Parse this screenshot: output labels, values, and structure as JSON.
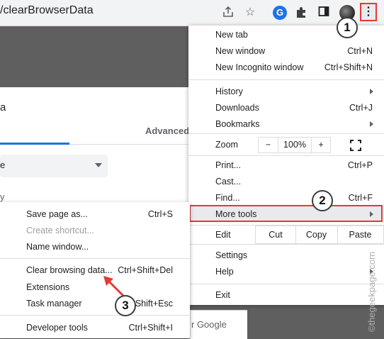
{
  "toolbar": {
    "url": "/clearBrowserData",
    "share_icon": "share-icon",
    "star_icon": "star-icon",
    "profile_letter": "G",
    "extensions_icon": "puzzle-icon",
    "sidepanel_icon": "side-panel-icon",
    "menu_icon": "⋮"
  },
  "background_page": {
    "title_fragment": "a",
    "advanced_tab": "Advanced",
    "select_fragment": "e",
    "label_fragment": "y",
    "google_fragment": "r Google"
  },
  "menu": {
    "new_tab": "New tab",
    "new_tab_shortcut": "",
    "new_window": "New window",
    "new_window_shortcut": "Ctrl+N",
    "new_incognito": "New Incognito window",
    "new_incognito_shortcut": "Ctrl+Shift+N",
    "history": "History",
    "downloads": "Downloads",
    "downloads_shortcut": "Ctrl+J",
    "bookmarks": "Bookmarks",
    "zoom": "Zoom",
    "zoom_minus": "−",
    "zoom_value": "100%",
    "zoom_plus": "+",
    "print": "Print...",
    "print_shortcut": "Ctrl+P",
    "cast": "Cast...",
    "find": "Find...",
    "find_shortcut": "Ctrl+F",
    "more_tools": "More tools",
    "edit": "Edit",
    "cut": "Cut",
    "copy": "Copy",
    "paste": "Paste",
    "settings": "Settings",
    "help": "Help",
    "exit": "Exit"
  },
  "submenu": {
    "save_page": "Save page as...",
    "save_page_shortcut": "Ctrl+S",
    "create_shortcut": "Create shortcut...",
    "name_window": "Name window...",
    "clear_browsing": "Clear browsing data...",
    "clear_browsing_shortcut": "Ctrl+Shift+Del",
    "extensions": "Extensions",
    "task_manager": "Task manager",
    "task_manager_shortcut": "Shift+Esc",
    "developer_tools": "Developer tools",
    "developer_tools_shortcut": "Ctrl+Shift+I"
  },
  "callouts": {
    "step1": "1",
    "step2": "2",
    "step3": "3"
  },
  "watermark": "©thegeekpage.com",
  "colors": {
    "highlight": "#e53935",
    "accent": "#1a73e8"
  }
}
